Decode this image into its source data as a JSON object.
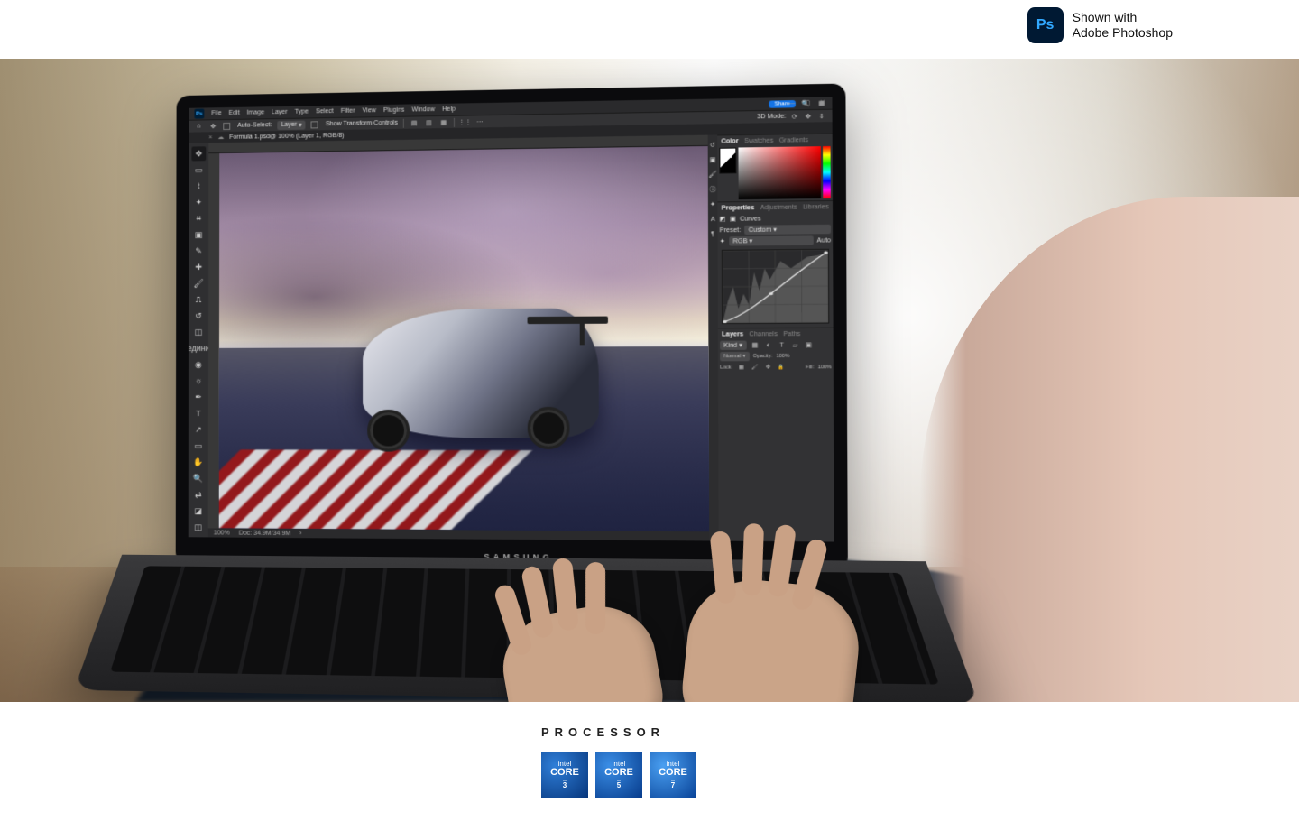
{
  "attribution": {
    "badge": "Ps",
    "line1": "Shown with",
    "line2": "Adobe Photoshop"
  },
  "laptop_brand": "SAMSUNG",
  "photoshop": {
    "menu": [
      "File",
      "Edit",
      "Image",
      "Layer",
      "Type",
      "Select",
      "Filter",
      "View",
      "Plugins",
      "Window",
      "Help"
    ],
    "share_label": "Share",
    "options": {
      "auto_select_label": "Auto-Select:",
      "auto_select_value": "Layer",
      "transform_label": "Show Transform Controls",
      "mode3d_label": "3D Mode:"
    },
    "doc_tab": "Formula 1.psd@ 100% (Layer 1, RGB/8)",
    "status": {
      "zoom": "100%",
      "doc": "Doc: 34.9M/34.9M"
    },
    "tools": [
      "move",
      "marquee",
      "lasso",
      "wand",
      "crop",
      "frame",
      "eyedropper",
      "heal",
      "brush",
      "stamp",
      "history-brush",
      "eraser",
      "gradient",
      "blur",
      "dodge",
      "pen",
      "type",
      "path",
      "rectangle",
      "hand",
      "zoom",
      "swap",
      "fg-bg",
      "mask"
    ],
    "panels": {
      "color_tabs": [
        "Color",
        "Swatches",
        "Gradients"
      ],
      "props_tabs": [
        "Properties",
        "Adjustments",
        "Libraries"
      ],
      "curves_label": "Curves",
      "preset_label": "Preset:",
      "preset_value": "Custom",
      "channel_value": "RGB",
      "auto_label": "Auto",
      "layers_tabs": [
        "Layers",
        "Channels",
        "Paths"
      ],
      "kind_label": "Kind",
      "blend_mode": "Normal",
      "opacity_label": "Opacity:",
      "opacity_value": "100%",
      "lock_label": "Lock:",
      "fill_label": "Fill:",
      "fill_value": "100%"
    }
  },
  "footer": {
    "heading": "PROCESSOR",
    "cores": [
      {
        "brand": "intel",
        "label": "CORE",
        "num": "3"
      },
      {
        "brand": "intel",
        "label": "CORE",
        "num": "5"
      },
      {
        "brand": "intel",
        "label": "CORE",
        "num": "7"
      }
    ]
  }
}
